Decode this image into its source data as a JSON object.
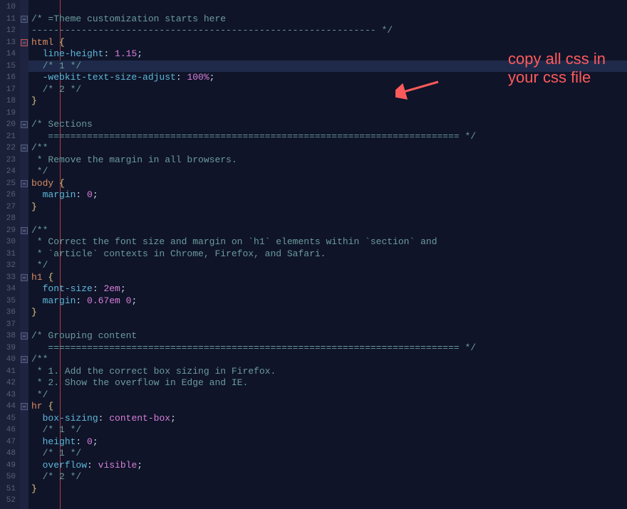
{
  "annotation": {
    "line1": "copy all css in",
    "line2": "your css file"
  },
  "startLine": 10,
  "highlightLineIndex": 5,
  "foldMarks": [
    {
      "lineIndex": 1,
      "style": "normal"
    },
    {
      "lineIndex": 3,
      "style": "red"
    },
    {
      "lineIndex": 10,
      "style": "normal"
    },
    {
      "lineIndex": 12,
      "style": "normal"
    },
    {
      "lineIndex": 15,
      "style": "normal"
    },
    {
      "lineIndex": 19,
      "style": "normal"
    },
    {
      "lineIndex": 23,
      "style": "normal"
    },
    {
      "lineIndex": 28,
      "style": "normal"
    },
    {
      "lineIndex": 30,
      "style": "normal"
    },
    {
      "lineIndex": 34,
      "style": "normal"
    }
  ],
  "lines": [
    {
      "tokens": []
    },
    {
      "tokens": [
        {
          "t": "/* =Theme customization starts here",
          "c": "c-comment"
        }
      ]
    },
    {
      "tokens": [
        {
          "t": "-------------------------------------------------------------- */",
          "c": "c-comment"
        }
      ]
    },
    {
      "tokens": [
        {
          "t": "html",
          "c": "c-sel"
        },
        {
          "t": " {",
          "c": "c-brace"
        }
      ]
    },
    {
      "tokens": [
        {
          "t": "  ",
          "c": ""
        },
        {
          "t": "line-height",
          "c": "c-prop"
        },
        {
          "t": ": ",
          "c": "c-punct"
        },
        {
          "t": "1.15",
          "c": "c-val"
        },
        {
          "t": ";",
          "c": "c-punct"
        }
      ]
    },
    {
      "tokens": [
        {
          "t": "  ",
          "c": ""
        },
        {
          "t": "/* 1 */",
          "c": "c-comment"
        }
      ]
    },
    {
      "tokens": [
        {
          "t": "  ",
          "c": ""
        },
        {
          "t": "-webkit-text-size-adjust",
          "c": "c-prop"
        },
        {
          "t": ": ",
          "c": "c-punct"
        },
        {
          "t": "100%",
          "c": "c-val"
        },
        {
          "t": ";",
          "c": "c-punct"
        }
      ]
    },
    {
      "tokens": [
        {
          "t": "  ",
          "c": ""
        },
        {
          "t": "/* 2 */",
          "c": "c-comment"
        }
      ]
    },
    {
      "tokens": [
        {
          "t": "}",
          "c": "c-brace"
        }
      ]
    },
    {
      "tokens": []
    },
    {
      "tokens": [
        {
          "t": "/* Sections",
          "c": "c-comment"
        }
      ]
    },
    {
      "tokens": [
        {
          "t": "   ========================================================================== */",
          "c": "c-comment"
        }
      ]
    },
    {
      "tokens": [
        {
          "t": "/**",
          "c": "c-comment"
        }
      ]
    },
    {
      "tokens": [
        {
          "t": " * Remove the margin in all browsers.",
          "c": "c-comment"
        }
      ]
    },
    {
      "tokens": [
        {
          "t": " */",
          "c": "c-comment"
        }
      ]
    },
    {
      "tokens": [
        {
          "t": "body",
          "c": "c-sel"
        },
        {
          "t": " {",
          "c": "c-brace"
        }
      ]
    },
    {
      "tokens": [
        {
          "t": "  ",
          "c": ""
        },
        {
          "t": "margin",
          "c": "c-prop"
        },
        {
          "t": ": ",
          "c": "c-punct"
        },
        {
          "t": "0",
          "c": "c-val"
        },
        {
          "t": ";",
          "c": "c-punct"
        }
      ]
    },
    {
      "tokens": [
        {
          "t": "}",
          "c": "c-brace"
        }
      ]
    },
    {
      "tokens": []
    },
    {
      "tokens": [
        {
          "t": "/**",
          "c": "c-comment"
        }
      ]
    },
    {
      "tokens": [
        {
          "t": " * Correct the font size and margin on `h1` elements within `section` and",
          "c": "c-comment"
        }
      ]
    },
    {
      "tokens": [
        {
          "t": " * `article` contexts in Chrome, Firefox, and Safari.",
          "c": "c-comment"
        }
      ]
    },
    {
      "tokens": [
        {
          "t": " */",
          "c": "c-comment"
        }
      ]
    },
    {
      "tokens": [
        {
          "t": "h1",
          "c": "c-sel"
        },
        {
          "t": " {",
          "c": "c-brace"
        }
      ]
    },
    {
      "tokens": [
        {
          "t": "  ",
          "c": ""
        },
        {
          "t": "font-size",
          "c": "c-prop"
        },
        {
          "t": ": ",
          "c": "c-punct"
        },
        {
          "t": "2em",
          "c": "c-val"
        },
        {
          "t": ";",
          "c": "c-punct"
        }
      ]
    },
    {
      "tokens": [
        {
          "t": "  ",
          "c": ""
        },
        {
          "t": "margin",
          "c": "c-prop"
        },
        {
          "t": ": ",
          "c": "c-punct"
        },
        {
          "t": "0.67em 0",
          "c": "c-val"
        },
        {
          "t": ";",
          "c": "c-punct"
        }
      ]
    },
    {
      "tokens": [
        {
          "t": "}",
          "c": "c-brace"
        }
      ]
    },
    {
      "tokens": []
    },
    {
      "tokens": [
        {
          "t": "/* Grouping content",
          "c": "c-comment"
        }
      ]
    },
    {
      "tokens": [
        {
          "t": "   ========================================================================== */",
          "c": "c-comment"
        }
      ]
    },
    {
      "tokens": [
        {
          "t": "/**",
          "c": "c-comment"
        }
      ]
    },
    {
      "tokens": [
        {
          "t": " * 1. Add the correct box sizing in Firefox.",
          "c": "c-comment"
        }
      ]
    },
    {
      "tokens": [
        {
          "t": " * 2. Show the overflow in Edge and IE.",
          "c": "c-comment"
        }
      ]
    },
    {
      "tokens": [
        {
          "t": " */",
          "c": "c-comment"
        }
      ]
    },
    {
      "tokens": [
        {
          "t": "hr",
          "c": "c-sel"
        },
        {
          "t": " {",
          "c": "c-brace"
        }
      ]
    },
    {
      "tokens": [
        {
          "t": "  ",
          "c": ""
        },
        {
          "t": "box-sizing",
          "c": "c-prop"
        },
        {
          "t": ": ",
          "c": "c-punct"
        },
        {
          "t": "content-box",
          "c": "c-val"
        },
        {
          "t": ";",
          "c": "c-punct"
        }
      ]
    },
    {
      "tokens": [
        {
          "t": "  ",
          "c": ""
        },
        {
          "t": "/* 1 */",
          "c": "c-comment"
        }
      ]
    },
    {
      "tokens": [
        {
          "t": "  ",
          "c": ""
        },
        {
          "t": "height",
          "c": "c-prop"
        },
        {
          "t": ": ",
          "c": "c-punct"
        },
        {
          "t": "0",
          "c": "c-val"
        },
        {
          "t": ";",
          "c": "c-punct"
        }
      ]
    },
    {
      "tokens": [
        {
          "t": "  ",
          "c": ""
        },
        {
          "t": "/* 1 */",
          "c": "c-comment"
        }
      ]
    },
    {
      "tokens": [
        {
          "t": "  ",
          "c": ""
        },
        {
          "t": "overflow",
          "c": "c-prop"
        },
        {
          "t": ": ",
          "c": "c-punct"
        },
        {
          "t": "visible",
          "c": "c-val"
        },
        {
          "t": ";",
          "c": "c-punct"
        }
      ]
    },
    {
      "tokens": [
        {
          "t": "  ",
          "c": ""
        },
        {
          "t": "/* 2 */",
          "c": "c-comment"
        }
      ]
    },
    {
      "tokens": [
        {
          "t": "}",
          "c": "c-brace"
        }
      ]
    },
    {
      "tokens": []
    }
  ]
}
